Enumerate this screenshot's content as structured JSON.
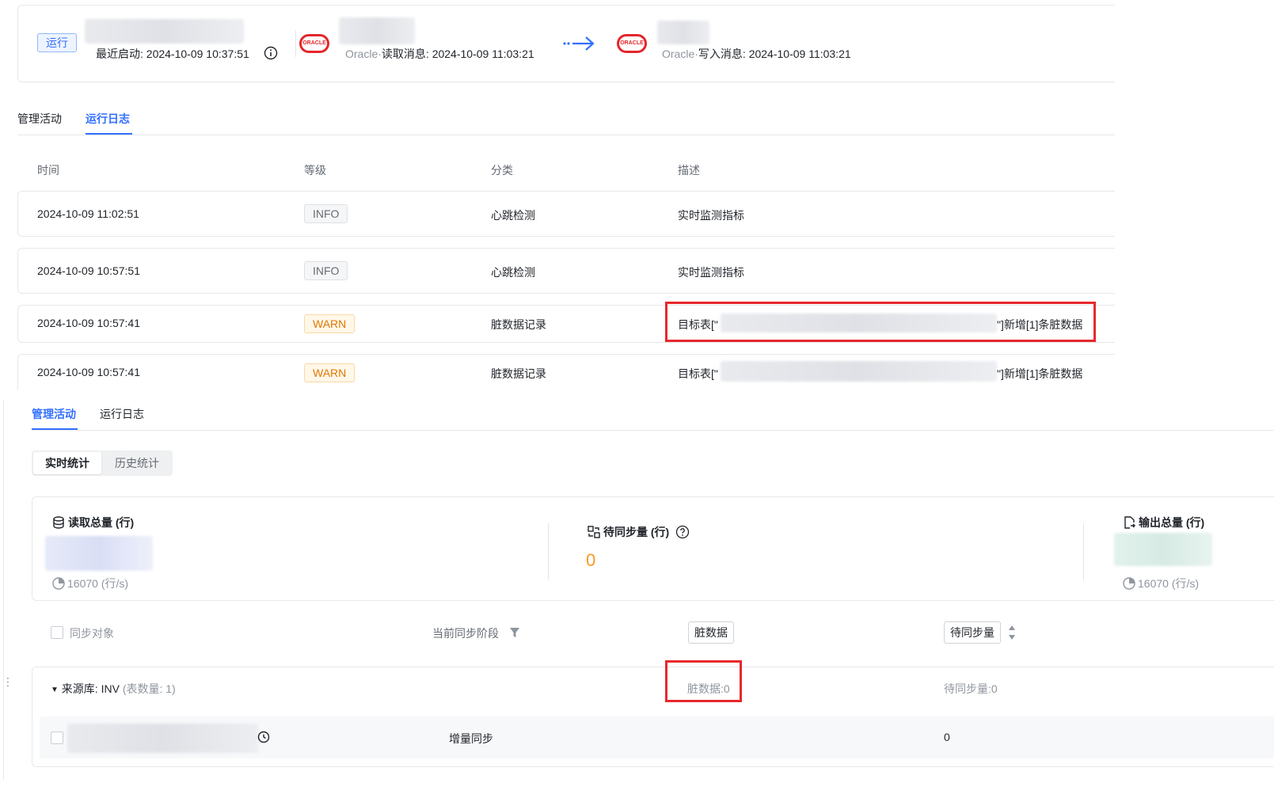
{
  "header": {
    "status": "运行",
    "last_start_label": "最近启动:",
    "last_start_time": "2024-10-09 10:37:51",
    "logo_text": "ORACLE",
    "source": {
      "prefix": "Oracle·",
      "label": "读取消息:",
      "time": "2024-10-09 11:03:21"
    },
    "target": {
      "prefix": "Oracle·",
      "label": "写入消息:",
      "time": "2024-10-09 11:03:21"
    }
  },
  "log_panel": {
    "tabs": [
      {
        "label": "管理活动"
      },
      {
        "label": "运行日志"
      }
    ],
    "columns": [
      "时间",
      "等级",
      "分类",
      "描述"
    ],
    "rows": [
      {
        "time": "2024-10-09 11:02:51",
        "level": "INFO",
        "category": "心跳检测",
        "desc_prefix": "实时监测指标",
        "desc_suffix": ""
      },
      {
        "time": "2024-10-09 10:57:51",
        "level": "INFO",
        "category": "心跳检测",
        "desc_prefix": "实时监测指标",
        "desc_suffix": ""
      },
      {
        "time": "2024-10-09 10:57:41",
        "level": "WARN",
        "category": "脏数据记录",
        "desc_prefix": "目标表[\"",
        "desc_suffix": "\"]新增[1]条脏数据"
      },
      {
        "time": "2024-10-09 10:57:41",
        "level": "WARN",
        "category": "脏数据记录",
        "desc_prefix": "目标表[\"",
        "desc_suffix": "\"]新增[1]条脏数据"
      }
    ]
  },
  "activity_panel": {
    "tabs": [
      {
        "label": "管理活动"
      },
      {
        "label": "运行日志"
      }
    ],
    "segments": [
      "实时统计",
      "历史统计"
    ],
    "stats": {
      "read": {
        "title": "读取总量 (行)",
        "rate": "16070 (行/s)"
      },
      "pending": {
        "title": "待同步量 (行)",
        "value": "0"
      },
      "output": {
        "title": "输出总量 (行)",
        "rate": "16070 (行/s)"
      }
    },
    "table_header": {
      "sync_object": "同步对象",
      "stage": "当前同步阶段",
      "dirty": "脏数据",
      "pending": "待同步量"
    },
    "group": {
      "source_label": "来源库:",
      "source_name": "INV",
      "table_count": "(表数量: 1)",
      "dirty_label": "脏数据:",
      "dirty_value": "0",
      "pending_label": "待同步量:",
      "pending_value": "0"
    },
    "row": {
      "stage": "增量同步",
      "pending": "0"
    }
  },
  "colors": {
    "accent": "#3370ff",
    "warn": "#de7802",
    "pending_zero": "#f59a23",
    "highlight_box": "#e8282d",
    "oracle_red": "#e3262a"
  }
}
